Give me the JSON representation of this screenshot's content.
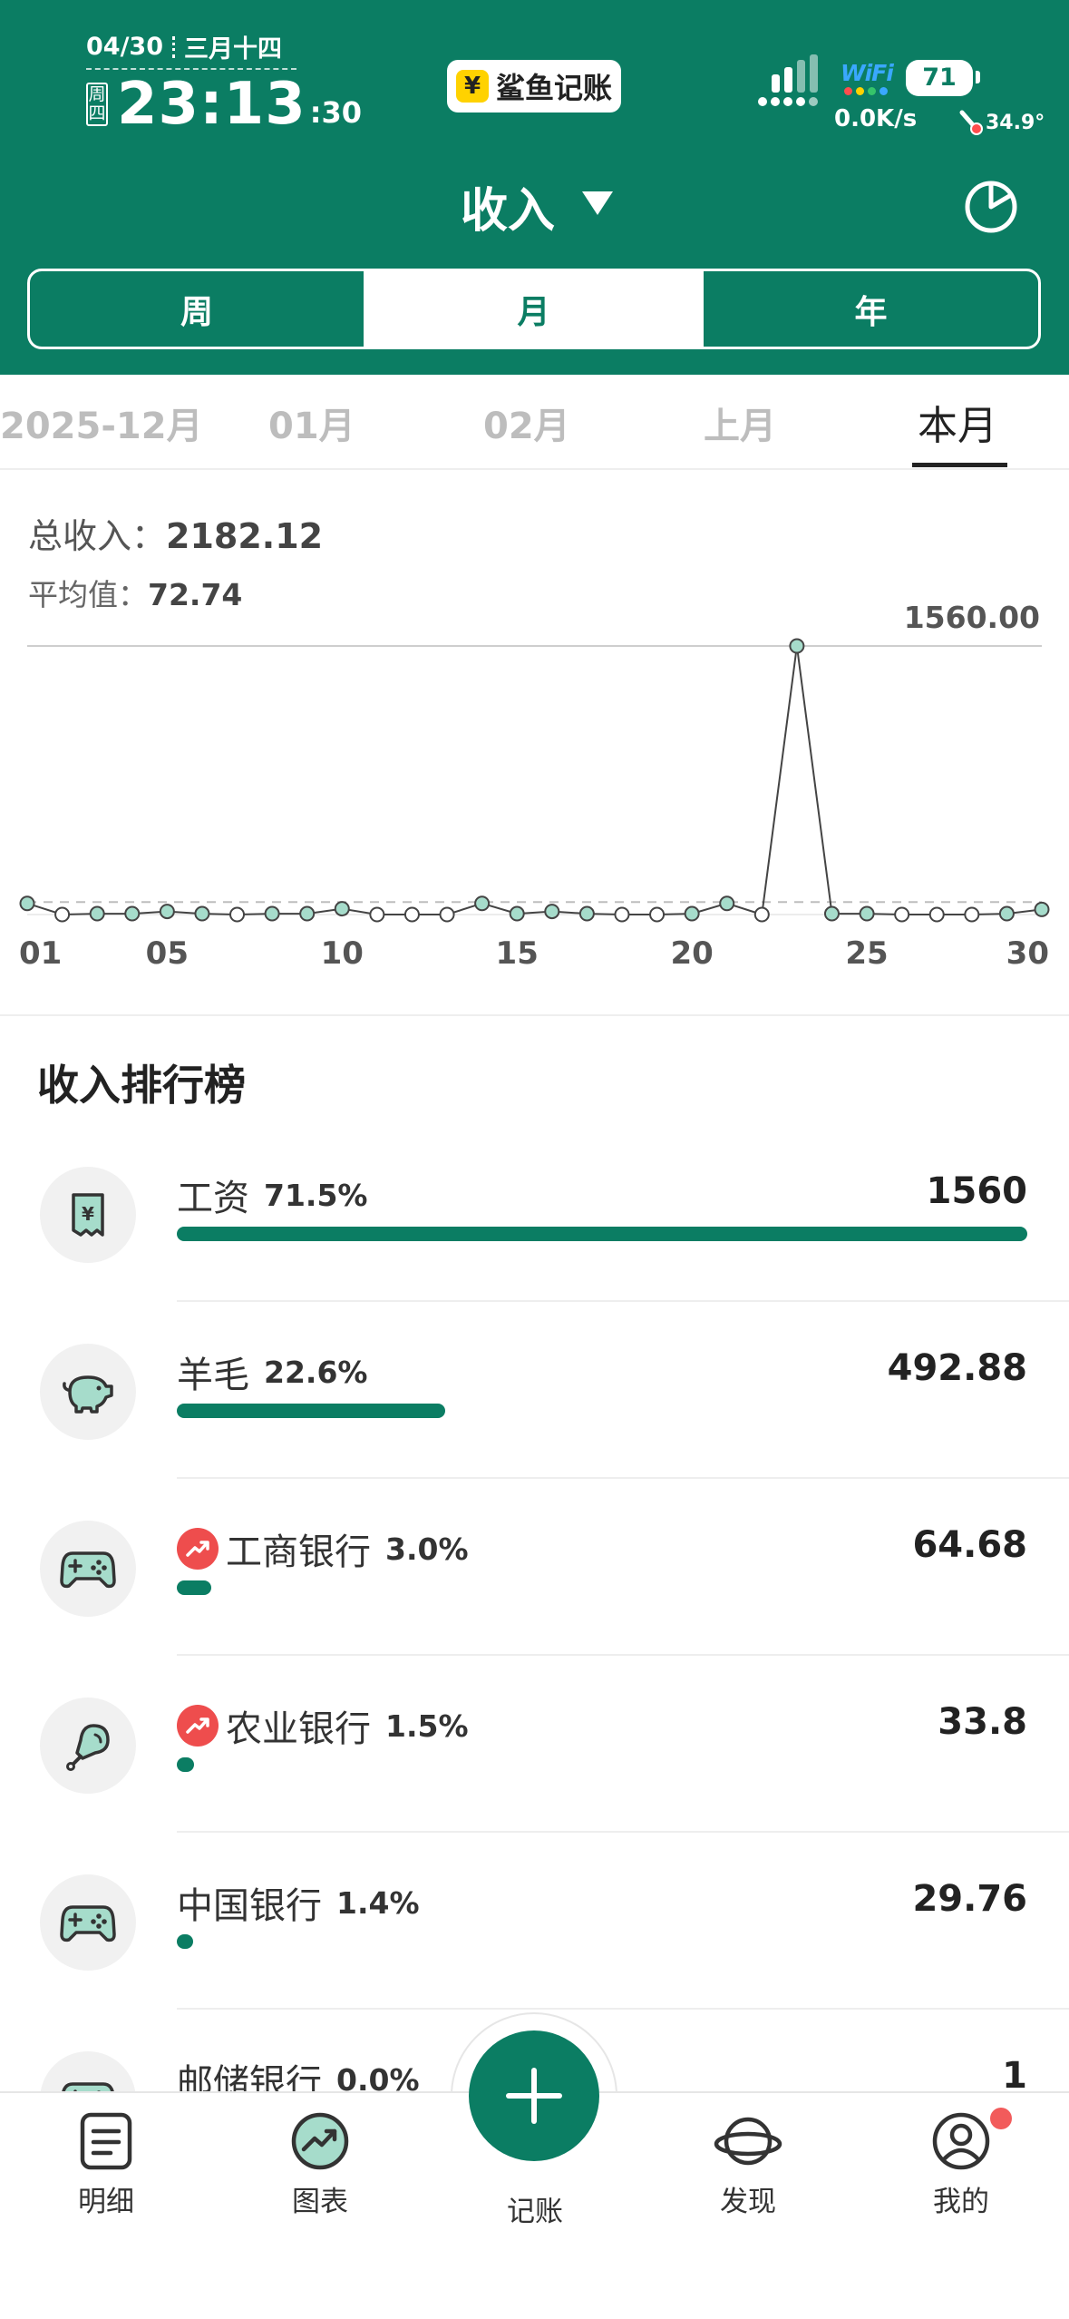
{
  "status_bar": {
    "date": "04/30",
    "lunar_date": "三月十四",
    "weekday": "周四",
    "time": "23:13",
    "seconds": ":30",
    "app_badge_icon": "¥",
    "app_badge_text": "鲨鱼记账",
    "wifi_label": "WiFi",
    "battery": "71",
    "net_speed": "0.0K/s",
    "temperature": "34.9°"
  },
  "header": {
    "title": "收入",
    "period_tabs": [
      {
        "label": "周",
        "active": false
      },
      {
        "label": "月",
        "active": true
      },
      {
        "label": "年",
        "active": false
      }
    ]
  },
  "month_tabs": [
    {
      "label": "2025-12月",
      "active": false
    },
    {
      "label": "01月",
      "active": false
    },
    {
      "label": "02月",
      "active": false
    },
    {
      "label": "上月",
      "active": false
    },
    {
      "label": "本月",
      "active": true
    }
  ],
  "summary": {
    "total_label": "总收入：",
    "total_value": "2182.12",
    "avg_label": "平均值：",
    "avg_value": "72.74"
  },
  "chart_data": {
    "type": "line",
    "max_label": "1560.00",
    "x_ticks": [
      "01",
      "05",
      "10",
      "15",
      "20",
      "25",
      "30"
    ],
    "x": [
      1,
      2,
      3,
      4,
      5,
      6,
      7,
      8,
      9,
      10,
      11,
      12,
      13,
      14,
      15,
      16,
      17,
      18,
      19,
      20,
      21,
      22,
      23,
      24,
      25,
      26,
      27,
      28,
      29,
      30
    ],
    "values": [
      64.68,
      0,
      5,
      5,
      18,
      5,
      0,
      5,
      5,
      33.8,
      0,
      0,
      0,
      64.68,
      5,
      18,
      5,
      0,
      0,
      5,
      64.68,
      0,
      1560,
      5,
      5,
      0,
      0,
      0,
      5,
      29.76
    ],
    "average": 72.74,
    "ylim": [
      0,
      1560
    ]
  },
  "ranking": {
    "title": "收入排行榜",
    "items": [
      {
        "name": "工资",
        "percent": "71.5%",
        "amount": "1560",
        "fraction": 1.0,
        "icon": "receipt-icon",
        "trend": false
      },
      {
        "name": "羊毛",
        "percent": "22.6%",
        "amount": "492.88",
        "fraction": 0.316,
        "icon": "piggy-bank-icon",
        "trend": false
      },
      {
        "name": "工商银行",
        "percent": "3.0%",
        "amount": "64.68",
        "fraction": 0.041,
        "icon": "gamepad-icon",
        "trend": true
      },
      {
        "name": "农业银行",
        "percent": "1.5%",
        "amount": "33.8",
        "fraction": 0.02,
        "icon": "drumstick-icon",
        "trend": true
      },
      {
        "name": "中国银行",
        "percent": "1.4%",
        "amount": "29.76",
        "fraction": 0.019,
        "icon": "gamepad-icon",
        "trend": false
      },
      {
        "name": "邮储银行",
        "percent": "0.0%",
        "amount": "1",
        "fraction": 0.0,
        "icon": "gamepad-icon",
        "trend": false
      }
    ]
  },
  "bottom_nav": {
    "items": [
      {
        "label": "明细",
        "icon": "document-icon"
      },
      {
        "label": "图表",
        "icon": "trend-chart-icon"
      },
      {
        "label": "记账",
        "icon": "plus-icon"
      },
      {
        "label": "发现",
        "icon": "planet-icon"
      },
      {
        "label": "我的",
        "icon": "user-icon"
      }
    ]
  },
  "colors": {
    "brand": "#0b7d63",
    "point_fill": "#a6dccb",
    "trend_badge": "#ee4d4d",
    "notification_dot": "#f25b5b"
  }
}
